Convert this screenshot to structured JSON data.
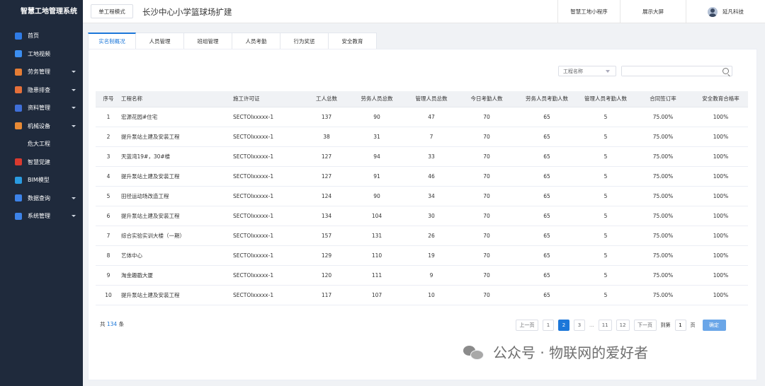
{
  "app": {
    "title": "智慧工地管理系统"
  },
  "sidebar": {
    "items": [
      {
        "label": "首页",
        "icon": "home-icon",
        "color": "#2f7be5",
        "expandable": false
      },
      {
        "label": "工地视频",
        "icon": "video-icon",
        "color": "#3c8ef0",
        "expandable": false
      },
      {
        "label": "劳务管理",
        "icon": "worker-icon",
        "color": "#e57d35",
        "expandable": true
      },
      {
        "label": "隐患排查",
        "icon": "hazard-icon",
        "color": "#e5703a",
        "expandable": true
      },
      {
        "label": "资料管理",
        "icon": "document-icon",
        "color": "#3f6fd8",
        "expandable": true
      },
      {
        "label": "机械设备",
        "icon": "machine-icon",
        "color": "#e88a35",
        "expandable": true
      },
      {
        "label": "危大工程",
        "icon": "",
        "color": "",
        "expandable": false,
        "sub": true
      },
      {
        "label": "智慧党建",
        "icon": "party-icon",
        "color": "#d93a2f",
        "expandable": false
      },
      {
        "label": "BIM模型",
        "icon": "bim-icon",
        "color": "#2a9be0",
        "expandable": false
      },
      {
        "label": "数据查询",
        "icon": "data-icon",
        "color": "#3d83e8",
        "expandable": true
      },
      {
        "label": "系统管理",
        "icon": "settings-icon",
        "color": "#3d83e8",
        "expandable": true
      }
    ]
  },
  "header": {
    "mode_button": "单工程模式",
    "project_title": "长沙中心小学篮球场扩建",
    "links": [
      "智慧工地小程序",
      "展示大屏"
    ],
    "user": "延凡科技"
  },
  "tabs": [
    {
      "label": "实名制概况",
      "active": true
    },
    {
      "label": "人员管理",
      "active": false
    },
    {
      "label": "班组管理",
      "active": false
    },
    {
      "label": "人员考勤",
      "active": false
    },
    {
      "label": "行为奖惩",
      "active": false
    },
    {
      "label": "安全教育",
      "active": false
    }
  ],
  "filter": {
    "select_label": "工程名称",
    "search_placeholder": ""
  },
  "table": {
    "headers": [
      "序号",
      "工程名称",
      "施工许可证",
      "工人总数",
      "劳务人员总数",
      "管理人员总数",
      "今日考勤人数",
      "劳务人员考勤人数",
      "管理人员考勤人数",
      "合同签订率",
      "安全教育合格率"
    ],
    "rows": [
      [
        "1",
        "宏源花园#住宅",
        "SECTOIxxxxx-1",
        "137",
        "90",
        "47",
        "70",
        "65",
        "5",
        "75.00%",
        "100%"
      ],
      [
        "2",
        "提升泵站土建及安装工程",
        "SECTOIxxxxx-1",
        "38",
        "31",
        "7",
        "70",
        "65",
        "5",
        "75.00%",
        "100%"
      ],
      [
        "3",
        "天蓝湾19#，30#楼",
        "SECTOIxxxxx-1",
        "127",
        "94",
        "33",
        "70",
        "65",
        "5",
        "75.00%",
        "100%"
      ],
      [
        "4",
        "提升泵站土建及安装工程",
        "SECTOIxxxxx-1",
        "127",
        "91",
        "46",
        "70",
        "65",
        "5",
        "75.00%",
        "100%"
      ],
      [
        "5",
        "田径运动场改造工程",
        "SECTOIxxxxx-1",
        "124",
        "90",
        "34",
        "70",
        "65",
        "5",
        "75.00%",
        "100%"
      ],
      [
        "6",
        "提升泵站土建及安装工程",
        "SECTOIxxxxx-1",
        "134",
        "104",
        "30",
        "70",
        "65",
        "5",
        "75.00%",
        "100%"
      ],
      [
        "7",
        "综合实验实训大楼（一期）",
        "SECTOIxxxxx-1",
        "157",
        "131",
        "26",
        "70",
        "65",
        "5",
        "75.00%",
        "100%"
      ],
      [
        "8",
        "艺体中心",
        "SECTOIxxxxx-1",
        "129",
        "110",
        "19",
        "70",
        "65",
        "5",
        "75.00%",
        "100%"
      ],
      [
        "9",
        "淘金趣戳大厦",
        "SECTOIxxxxx-1",
        "120",
        "111",
        "9",
        "70",
        "65",
        "5",
        "75.00%",
        "100%"
      ],
      [
        "10",
        "提升泵站土建及安装工程",
        "SECTOIxxxxx-1",
        "117",
        "107",
        "10",
        "70",
        "65",
        "5",
        "75.00%",
        "100%"
      ]
    ]
  },
  "pagination": {
    "total_prefix": "共",
    "total": "134",
    "total_suffix": "条",
    "prev": "上一页",
    "pages": [
      "1",
      "2",
      "3"
    ],
    "current": "2",
    "ellipsis": "...",
    "tail_pages": [
      "11",
      "12"
    ],
    "next": "下一页",
    "jump_label": "到第",
    "jump_value": "1",
    "jump_unit": "页",
    "confirm": "确定"
  },
  "watermark": {
    "text": "公众号 · 物联网的爱好者"
  },
  "colors": {
    "accent": "#1c77d9",
    "sidebar_bg": "#1f2a3c"
  }
}
